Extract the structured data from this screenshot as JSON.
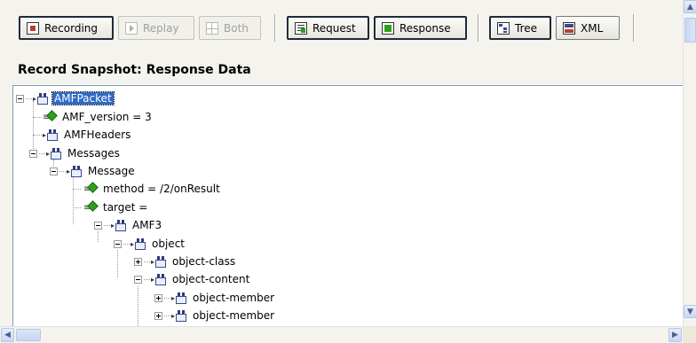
{
  "toolbar": {
    "recording_label": "Recording",
    "replay_label": "Replay",
    "both_label": "Both",
    "request_label": "Request",
    "response_label": "Response",
    "tree_label": "Tree",
    "xml_label": "XML"
  },
  "snapshot": {
    "title": "Record Snapshot: Response Data"
  },
  "tree": {
    "nodes": [
      {
        "label": "AMFPacket",
        "selected": true,
        "icon": "node-icon"
      },
      {
        "label": "AMF_version = 3",
        "icon": "leaf-icon"
      },
      {
        "label": "AMFHeaders",
        "icon": "node-icon"
      },
      {
        "label": "Messages",
        "icon": "node-icon"
      },
      {
        "label": "Message",
        "icon": "node-icon"
      },
      {
        "label": "method = /2/onResult",
        "icon": "leaf-icon"
      },
      {
        "label": "target =",
        "icon": "leaf-icon"
      },
      {
        "label": "AMF3",
        "icon": "node-icon"
      },
      {
        "label": "object",
        "icon": "node-icon"
      },
      {
        "label": "object-class",
        "icon": "node-icon"
      },
      {
        "label": "object-content",
        "icon": "node-icon"
      },
      {
        "label": "object-member",
        "icon": "node-icon"
      },
      {
        "label": "object-member",
        "icon": "node-icon"
      }
    ]
  },
  "icons": {
    "scroll_up": "▲",
    "scroll_down": "▼",
    "scroll_left": "◀",
    "scroll_right": "▶"
  },
  "colors": {
    "selection": "#316ac5",
    "leaf_gem": "#2da01c"
  }
}
